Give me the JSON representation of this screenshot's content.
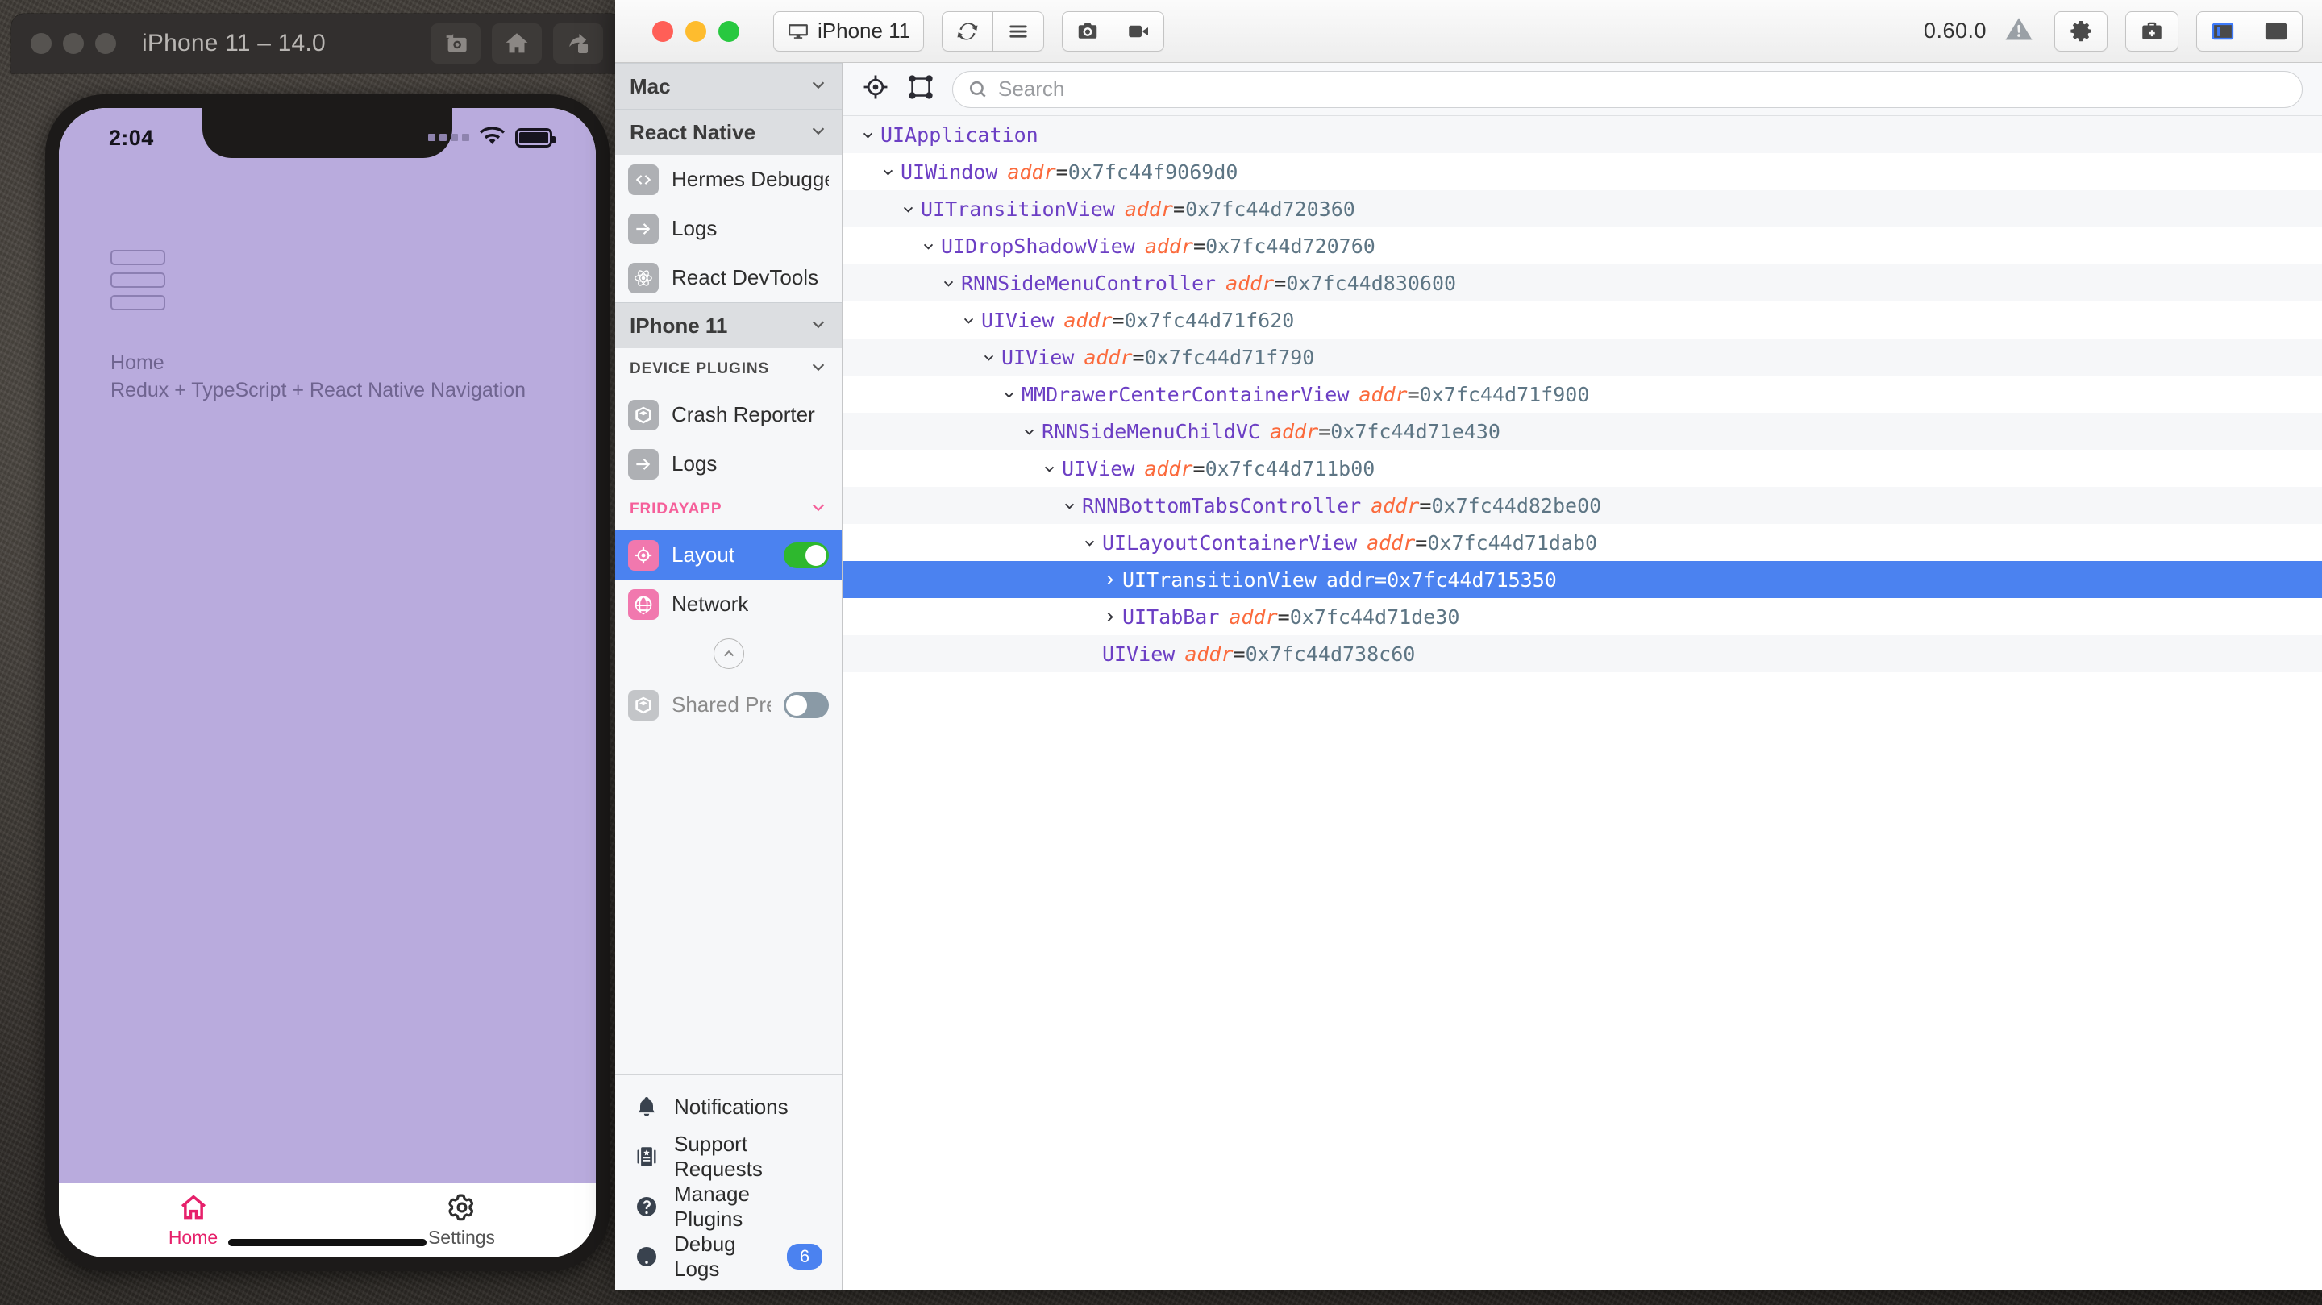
{
  "simulator": {
    "title": "iPhone 11 – 14.0",
    "toolbar_icons": [
      "screenshot-camera-icon",
      "home-icon",
      "share-icon"
    ],
    "status_bar": {
      "time": "2:04",
      "wifi": "wifi-icon",
      "battery": "battery-icon",
      "signal": "signal-dots-icon"
    },
    "app": {
      "menu_icon": "hamburger-menu-icon",
      "heading": "Home",
      "subtitle": "Redux + TypeScript + React Native Navigation",
      "tabs": [
        {
          "label": "Home",
          "icon": "home-icon",
          "active": true
        },
        {
          "label": "Settings",
          "icon": "gear-icon",
          "active": false
        }
      ]
    }
  },
  "flipper": {
    "toolbar": {
      "device_label": "iPhone 11",
      "device_icon": "monitor-icon",
      "reload_icon": "reload-icon",
      "menu_icon": "hamburger-icon",
      "camera_icon": "camera-icon",
      "video_icon": "video-record-icon",
      "version": "0.60.0",
      "warning_icon": "warning-triangle-icon",
      "settings_icon": "gear-icon",
      "doctor_icon": "medical-bag-icon",
      "left_panel_icon": "toggle-left-sidebar-icon",
      "right_panel_icon": "toggle-right-sidebar-icon"
    },
    "sidebar": {
      "sections": [
        {
          "type": "header",
          "label": "Mac",
          "name": "sidebar-section-mac",
          "items": []
        },
        {
          "type": "header",
          "label": "React Native",
          "name": "sidebar-section-react-native",
          "items": [
            {
              "label": "Hermes Debugger (RN)",
              "icon": "code-brackets-icon",
              "name": "sidebar-item-hermes-debugger"
            },
            {
              "label": "Logs",
              "icon": "arrow-right-icon",
              "name": "sidebar-item-logs-rn"
            },
            {
              "label": "React DevTools",
              "icon": "react-atom-icon",
              "name": "sidebar-item-react-devtools"
            }
          ]
        },
        {
          "type": "header",
          "label": "IPhone 11",
          "name": "sidebar-section-iphone-11",
          "sublabel": "DEVICE PLUGINS",
          "items": [
            {
              "label": "Crash Reporter",
              "icon": "cube-icon",
              "name": "sidebar-item-crash-reporter"
            },
            {
              "label": "Logs",
              "icon": "arrow-right-icon",
              "name": "sidebar-item-logs-device"
            }
          ]
        }
      ],
      "app_section": {
        "label": "FRIDAYAPP",
        "color": "#f55f9a",
        "items": [
          {
            "label": "Layout",
            "icon": "crosshair-target-icon",
            "name": "sidebar-item-layout",
            "selected": true,
            "toggle": "on"
          },
          {
            "label": "Network",
            "icon": "globe-icon",
            "name": "sidebar-item-network",
            "selected": false,
            "toggle": null
          },
          {
            "label": "Shared Preferen",
            "icon": "cube-icon",
            "name": "sidebar-item-shared-preferences",
            "selected": false,
            "dim": true,
            "toggle": "off"
          }
        ],
        "collapse_icon": "chevron-up-circle-icon"
      },
      "bottom_items": [
        {
          "label": "Notifications",
          "icon": "bell-icon",
          "name": "sidebar-item-notifications",
          "badge": null
        },
        {
          "label": "Support Requests",
          "icon": "support-book-icon",
          "name": "sidebar-item-support-requests",
          "badge": null
        },
        {
          "label": "Manage Plugins",
          "icon": "question-circle-icon",
          "name": "sidebar-item-manage-plugins",
          "badge": null
        },
        {
          "label": "Debug Logs",
          "icon": "exclamation-circle-icon",
          "name": "sidebar-item-debug-logs",
          "badge": "6"
        }
      ]
    },
    "content": {
      "target_icon": "crosshair-target-icon",
      "bounds_icon": "bounding-box-icon",
      "search_placeholder": "Search",
      "search_value": "",
      "tree": [
        {
          "depth": 0,
          "arrow": "down",
          "name": "UIApplication",
          "attr": "",
          "value": ""
        },
        {
          "depth": 1,
          "arrow": "down",
          "name": "UIWindow",
          "attr": "addr",
          "value": "0x7fc44f9069d0"
        },
        {
          "depth": 2,
          "arrow": "down",
          "name": "UITransitionView",
          "attr": "addr",
          "value": "0x7fc44d720360"
        },
        {
          "depth": 3,
          "arrow": "down",
          "name": "UIDropShadowView",
          "attr": "addr",
          "value": "0x7fc44d720760"
        },
        {
          "depth": 4,
          "arrow": "down",
          "name": "RNNSideMenuController",
          "attr": "addr",
          "value": "0x7fc44d830600"
        },
        {
          "depth": 5,
          "arrow": "down",
          "name": "UIView",
          "attr": "addr",
          "value": "0x7fc44d71f620"
        },
        {
          "depth": 6,
          "arrow": "down",
          "name": "UIView",
          "attr": "addr",
          "value": "0x7fc44d71f790"
        },
        {
          "depth": 7,
          "arrow": "down",
          "name": "MMDrawerCenterContainerView",
          "attr": "addr",
          "value": "0x7fc44d71f900"
        },
        {
          "depth": 8,
          "arrow": "down",
          "name": "RNNSideMenuChildVC",
          "attr": "addr",
          "value": "0x7fc44d71e430"
        },
        {
          "depth": 9,
          "arrow": "down",
          "name": "UIView",
          "attr": "addr",
          "value": "0x7fc44d711b00"
        },
        {
          "depth": 10,
          "arrow": "down",
          "name": "RNNBottomTabsController",
          "attr": "addr",
          "value": "0x7fc44d82be00"
        },
        {
          "depth": 11,
          "arrow": "down",
          "name": "UILayoutContainerView",
          "attr": "addr",
          "value": "0x7fc44d71dab0"
        },
        {
          "depth": 12,
          "arrow": "right",
          "name": "UITransitionView",
          "attr": "addr",
          "value": "0x7fc44d715350",
          "selected": true
        },
        {
          "depth": 12,
          "arrow": "right",
          "name": "UITabBar",
          "attr": "addr",
          "value": "0x7fc44d71de30"
        },
        {
          "depth": 11,
          "arrow": "none",
          "name": "UIView",
          "attr": "addr",
          "value": "0x7fc44d738c60"
        }
      ]
    }
  }
}
